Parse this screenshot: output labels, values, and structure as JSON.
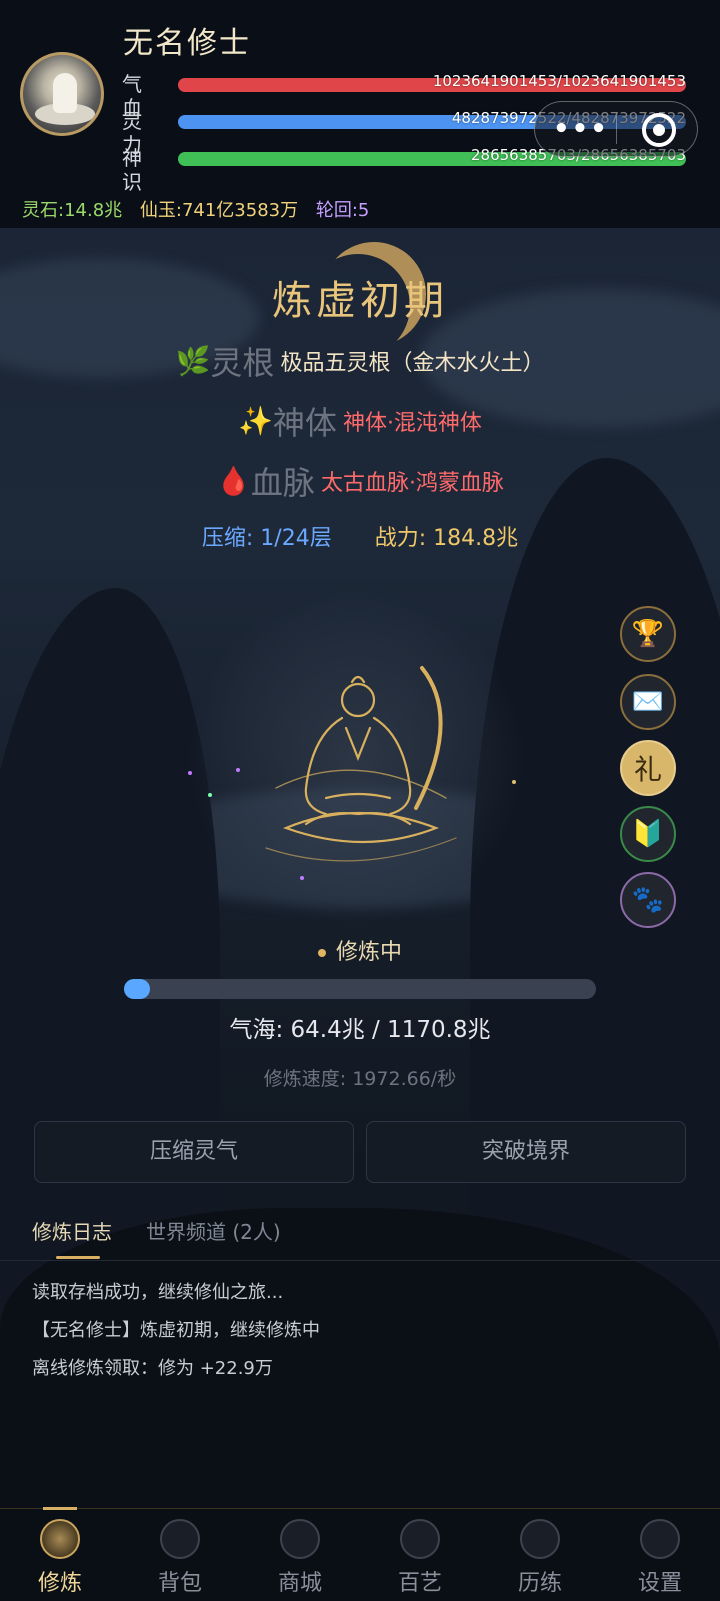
{
  "player": {
    "name": "无名修士",
    "hp": {
      "label": "气血",
      "text": "1023641901453/1023641901453",
      "ratio": 1.0
    },
    "mp": {
      "label": "灵力",
      "text": "482873972522/482873972522",
      "ratio": 1.0
    },
    "sp": {
      "label": "神识",
      "text": "28656385703/28656385703",
      "ratio": 1.0
    }
  },
  "currency": {
    "stone": "灵石:14.8兆",
    "jade": "仙玉:741亿3583万",
    "cycle": "轮回:5"
  },
  "capsule": {
    "more": "•••"
  },
  "realm": "炼虚初期",
  "traits": {
    "root": {
      "icon": "🌿",
      "label": "灵根",
      "value": "极品五灵根（金木水火土）"
    },
    "body": {
      "icon": "✨",
      "label": "神体",
      "value": "神体·混沌神体"
    },
    "blood": {
      "icon": "🩸",
      "label": "血脉",
      "value": "太古血脉·鸿蒙血脉"
    }
  },
  "compress": "压缩: 1/24层",
  "power": "战力: 184.8兆",
  "side_buttons": {
    "trophy": "🏆",
    "mail": "✉️",
    "gift": "礼",
    "guide": "🔰",
    "pet": "🐾"
  },
  "cultivation": {
    "status": "修炼中",
    "progress": 0.055,
    "qi_sea": "气海: 64.4兆 / 1170.8兆",
    "speed": "修炼速度: 1972.66/秒"
  },
  "actions": {
    "compress": "压缩灵气",
    "breakthrough": "突破境界"
  },
  "tabs": {
    "log": "修炼日志",
    "world": "世界频道 (2人)"
  },
  "logs": [
    "读取存档成功，继续修仙之旅...",
    "【无名修士】炼虚初期，继续修炼中",
    "离线修炼领取：修为 +22.9万"
  ],
  "nav": [
    {
      "label": "修炼"
    },
    {
      "label": "背包"
    },
    {
      "label": "商城"
    },
    {
      "label": "百艺"
    },
    {
      "label": "历练"
    },
    {
      "label": "设置"
    }
  ]
}
